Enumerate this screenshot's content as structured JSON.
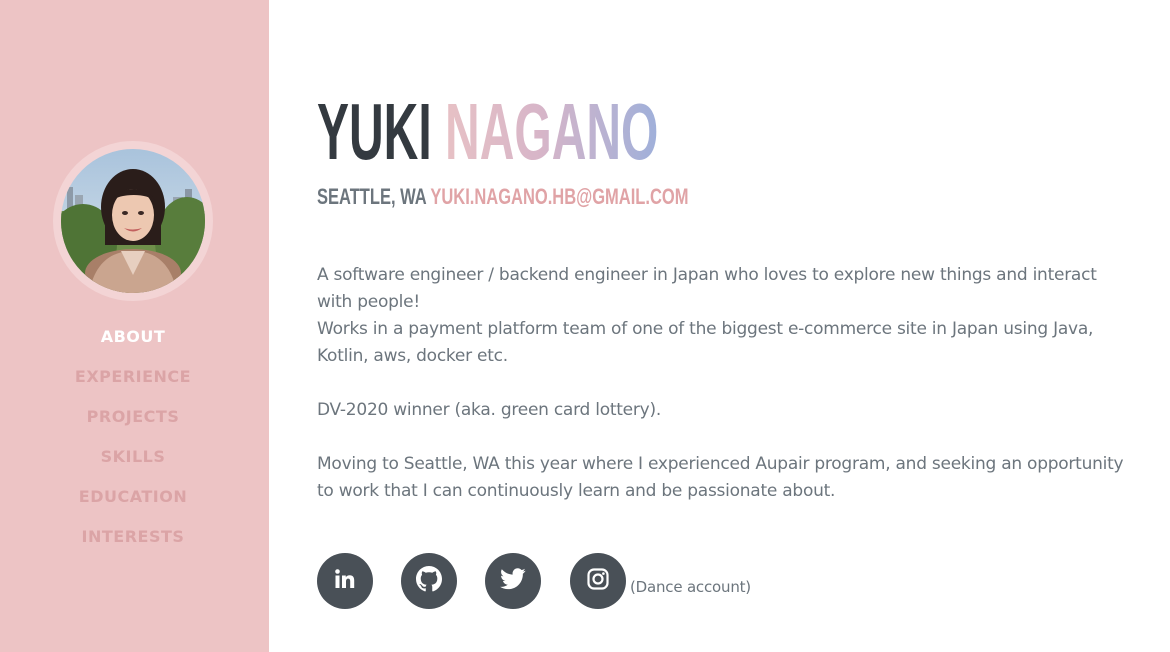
{
  "profile": {
    "first_name": "YUKI",
    "last_name": "NAGANO",
    "location": "SEATTLE, WA",
    "email": "YUKI.NAGANO.HB@GMAIL.COM"
  },
  "sidebar": {
    "nav": [
      {
        "label": "ABOUT",
        "active": true
      },
      {
        "label": "EXPERIENCE",
        "active": false
      },
      {
        "label": "PROJECTS",
        "active": false
      },
      {
        "label": "SKILLS",
        "active": false
      },
      {
        "label": "EDUCATION",
        "active": false
      },
      {
        "label": "INTERESTS",
        "active": false
      }
    ]
  },
  "about": {
    "bio_1": "A software engineer / backend engineer in Japan who loves to explore new things and interact with people!",
    "bio_2": "Works in a payment platform team of one of the biggest e-commerce site in Japan using Java, Kotlin, aws, docker etc.",
    "bio_3": "DV-2020 winner (aka. green card lottery).",
    "bio_4": "Moving to Seattle, WA this year where I experienced Aupair program, and seeking an opportunity to work that I can continuously learn and be passionate about."
  },
  "social": {
    "links": [
      {
        "icon": "linkedin-icon"
      },
      {
        "icon": "github-icon"
      },
      {
        "icon": "twitter-icon"
      },
      {
        "icon": "instagram-icon"
      }
    ],
    "instagram_note": "(Dance account)"
  },
  "colors": {
    "sidebar_bg": "#edc4c5",
    "nav_inactive": "#dba4a6",
    "nav_active": "#ffffff",
    "heading_dark": "#343a40",
    "accent_pink": "#e0a3a6",
    "text_gray": "#6c757d",
    "social_button": "#495057"
  }
}
